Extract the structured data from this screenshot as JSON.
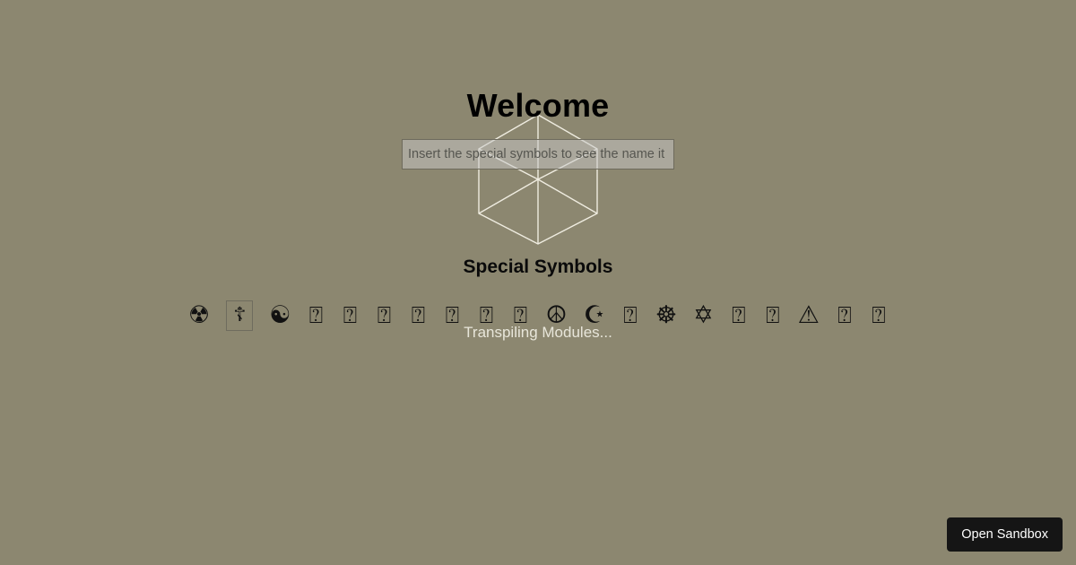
{
  "page": {
    "background_color": "#8c8770",
    "title": "Welcome",
    "section_title": "Special Symbols"
  },
  "search": {
    "name": "special-symbol-search",
    "value": "",
    "placeholder": "Insert the special symbols to see the name it belong t"
  },
  "symbols": [
    {
      "glyph": "☢",
      "name": "radioactive-sign-symbol",
      "style": "plain"
    },
    {
      "glyph": "☦",
      "name": "orthodox-cross-symbol",
      "style": "boxed"
    },
    {
      "glyph": "☯",
      "name": "yin-yang-symbol",
      "style": "plain"
    },
    {
      "glyph": "⍰",
      "name": "missing-glyph-symbol-1",
      "style": "tofu"
    },
    {
      "glyph": "⍰",
      "name": "missing-glyph-symbol-2",
      "style": "tofu"
    },
    {
      "glyph": "⍰",
      "name": "missing-glyph-symbol-3",
      "style": "tofu"
    },
    {
      "glyph": "⍰",
      "name": "missing-glyph-symbol-4",
      "style": "tofu"
    },
    {
      "glyph": "⍰",
      "name": "missing-glyph-symbol-5",
      "style": "tofu"
    },
    {
      "glyph": "⍰",
      "name": "missing-glyph-symbol-6",
      "style": "tofu"
    },
    {
      "glyph": "⍰",
      "name": "missing-glyph-symbol-7",
      "style": "tofu"
    },
    {
      "glyph": "☮",
      "name": "peace-sign-symbol",
      "style": "plain"
    },
    {
      "glyph": "☪",
      "name": "star-and-crescent-symbol",
      "style": "plain"
    },
    {
      "glyph": "⍰",
      "name": "missing-glyph-symbol-8",
      "style": "tofu"
    },
    {
      "glyph": "☸",
      "name": "wheel-of-dharma-symbol",
      "style": "plain"
    },
    {
      "glyph": "✡",
      "name": "star-of-david-symbol",
      "style": "plain"
    },
    {
      "glyph": "⍰",
      "name": "missing-glyph-symbol-9",
      "style": "tofu"
    },
    {
      "glyph": "⍰",
      "name": "missing-glyph-symbol-10",
      "style": "tofu"
    },
    {
      "glyph": "⚠",
      "name": "warning-sign-symbol",
      "style": "plain"
    },
    {
      "glyph": "⍰",
      "name": "missing-glyph-symbol-11",
      "style": "tofu"
    },
    {
      "glyph": "⍰",
      "name": "missing-glyph-symbol-12",
      "style": "tofu"
    }
  ],
  "loader": {
    "name": "hexagon-cube-loader",
    "stroke_color": "#efece0"
  },
  "status": {
    "loading_text": "Transpiling Modules..."
  },
  "footer": {
    "sandbox_label": "Open Sandbox",
    "sandbox_background": "#151515"
  }
}
